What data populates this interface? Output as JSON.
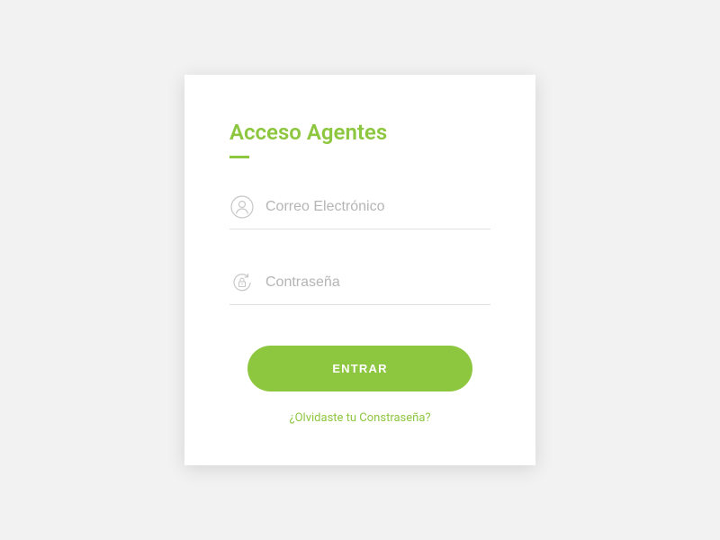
{
  "login": {
    "title": "Acceso Agentes",
    "email_placeholder": "Correo Electrónico",
    "password_placeholder": "Contraseña",
    "submit_label": "ENTRAR",
    "forgot_label": "¿Olvidaste tu Constraseña?"
  },
  "colors": {
    "accent": "#8dc63f",
    "background": "#f2f2f2",
    "card": "#ffffff"
  }
}
